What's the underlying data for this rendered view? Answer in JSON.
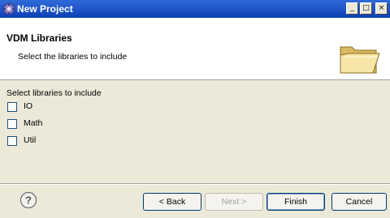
{
  "window": {
    "title": "New Project",
    "minimize_glyph": "_",
    "maximize_glyph": "□",
    "close_glyph": "×"
  },
  "banner": {
    "title": "VDM Libraries",
    "description": "Select the libraries to include",
    "image_icon": "folder-open-icon"
  },
  "libraries": {
    "label": "Select libraries to include",
    "items": [
      {
        "label": "IO",
        "checked": false
      },
      {
        "label": "Math",
        "checked": false
      },
      {
        "label": "Util",
        "checked": false
      }
    ]
  },
  "buttons": {
    "help_icon": "help-icon",
    "back": "< Back",
    "next": "Next >",
    "finish": "Finish",
    "cancel": "Cancel"
  },
  "colors": {
    "titlebar": "#0a3fb5",
    "dialog_background": "#ece9d8",
    "disabled_text": "#a0a0a0"
  }
}
